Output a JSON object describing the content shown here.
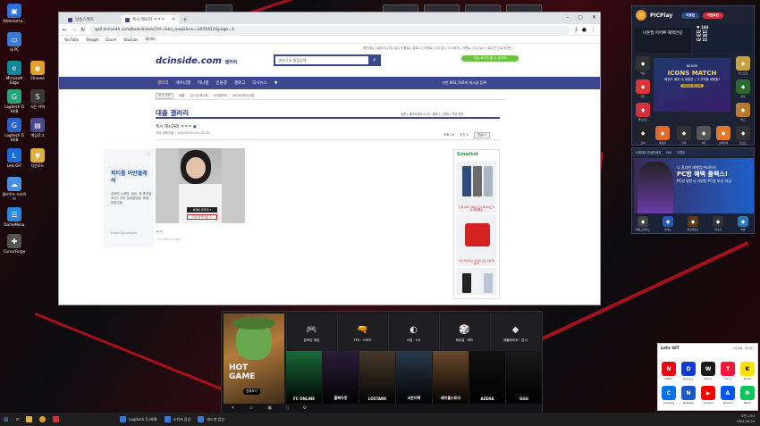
{
  "desktop_icons": [
    {
      "label": "Administra...",
      "color": "#2f6fd6",
      "glyph": "▣"
    },
    {
      "label": "내 PC",
      "color": "#3a7bd5",
      "glyph": "▭"
    },
    {
      "label": "Microsoft Edge",
      "color": "#0f8a9d",
      "glyph": "e"
    },
    {
      "label": "Logitech G HUB",
      "color": "#26a37a",
      "glyph": "G"
    },
    {
      "label": "Chrome",
      "color": "#e0a02a",
      "glyph": "◉"
    },
    {
      "label": "Logitech G HUB",
      "color": "#2a64c8",
      "glyph": "G"
    },
    {
      "label": "서든 어택",
      "color": "#3a3a3a",
      "glyph": "S"
    },
    {
      "label": "게임로그",
      "color": "#4a4a8a",
      "glyph": "▤"
    },
    {
      "label": "Lets OIT",
      "color": "#1f6bd6",
      "glyph": "L"
    },
    {
      "label": "다운로드",
      "color": "#e0b03a",
      "glyph": "▼"
    },
    {
      "label": "클라우드 드라이브",
      "color": "#4a90e2",
      "glyph": "☁"
    },
    {
      "label": "GameMenu",
      "color": "#2a88d8",
      "glyph": "☰"
    },
    {
      "label": "CursorForge",
      "color": "#555",
      "glyph": "✚"
    },
    {
      "label": "aaaaaaa...",
      "color": "#c8441f",
      "glyph": "▲"
    }
  ],
  "top_labels": [
    "스피커 음성",
    "게임 유저",
    "헤드셋",
    "스피커"
  ],
  "browser": {
    "tabs": [
      {
        "label": "방송스케치"
      },
      {
        "label": "혹시 제시카 ㅋㅋㅋ"
      }
    ],
    "url": "gall.dcinside.com/board/view/?id=loan_new1&no=1835912&page=1",
    "bookmarks": [
      "YouTube",
      "Google",
      "Daum",
      "YouTube",
      "네이버"
    ]
  },
  "dc": {
    "top_links": "메인메뉴 | 갤러리 | 미니갤 | 인물갤 | 갤로그 | 이벤트 | 디시콘 | 디시위키 | 이벤트 | 디시뉴스 | 로그인 | 로그아웃",
    "logo": "dcinside.com",
    "logo_sub": "갤러리",
    "search_placeholder": "갤러리 & 통합검색",
    "green_btn": "지금 로그인 할 수 있어요",
    "nav": [
      "갤러리",
      "게이너갤",
      "미니갤",
      "인물갤",
      "갤로그",
      "디시뉴스"
    ],
    "nav_right": "이번 893,746개 게시글 등록",
    "subnav": [
      "최근 방문",
      "대출",
      "실시간 베스트",
      "HIT갤러리",
      "WOW 마이너갤"
    ],
    "gallery_title": "대출 갤러리",
    "gallery_tools": "설정 | 갤러리정보(1/3) | 갤로그 | 알림 | 저장 관리",
    "post_title": "혹시 제시카라 ㅋㅋㅋ",
    "post_meta": "이와 영화어물 | 2024.09.24 05:52:48",
    "stats": {
      "views": "조회 26",
      "recommend": "추천 0",
      "comments": "댓글 0"
    },
    "caption1": "처제와 끝까지??",
    "caption2": "가장 대 즐거운 가",
    "post_text": "ㅋㅋ",
    "post_foot": "- dc official App",
    "left_ad": {
      "title": "피티룸 어반클래식",
      "desc": "주택안 노래방, 로비, 휴 휴게실 40인, 주방 실내멀당닭, 뷔페, 연회주점",
      "url": "https://sportsvib"
    },
    "right_ad": {
      "brand": "Gmarket",
      "cap1": "남성 바지 신축성 스판 빅사이즈 5분 해외배송",
      "cap2": "작가 빅사이즈 반팔티 요즈 5분 배송 빅"
    }
  },
  "dock": {
    "feature": {
      "title_line1": "HOT",
      "title_line2": "GAME",
      "button": "전체보기"
    },
    "categories": [
      {
        "label": "온라인 게임",
        "icon": "🎮"
      },
      {
        "label": "FPS · 스포츠",
        "icon": "🔫"
      },
      {
        "label": "스팀 · CD",
        "icon": "◐"
      },
      {
        "label": "캐주얼 · 보드",
        "icon": "🎲"
      },
      {
        "label": "배틀라이트 · 콘시",
        "icon": "◆"
      }
    ],
    "tiles": [
      {
        "label": "FC ONLINE",
        "bg": "#1a6a3a"
      },
      {
        "label": "블랙아웃",
        "bg": "#2b1e3a"
      },
      {
        "label": "LOSTARK",
        "bg": "#4a3a2a"
      },
      {
        "label": "서든어택",
        "bg": "#2a3a4a"
      },
      {
        "label": "메이플스토리",
        "bg": "#6a4a2a"
      },
      {
        "label": "AZERA",
        "bg": "#111"
      },
      {
        "label": "GGG",
        "bg": "#1a1a1a"
      }
    ]
  },
  "pcplay": {
    "title": "PICPlay",
    "btn1": "이용권",
    "btn2": "이벤트관",
    "promo": "나온엘 머어쁘 혜택안녕",
    "stats": "♥ 144\nLV 12\nLV 34\nLV 22",
    "banner_title": "ICONS MATCH",
    "banner_sub": "NEXON",
    "banner_desc": "레전드 매치 대 대결전 | 그 구력을 대탐험!",
    "banner_date": "2024.10.20",
    "grid": [
      {
        "label": "넥슨",
        "color": "#333"
      },
      {
        "label": "카트",
        "color": "#d33"
      },
      {
        "label": "발로란트",
        "color": "#d3303a"
      },
      {
        "label": "리그오브",
        "color": "#c9a13a"
      },
      {
        "label": "피파",
        "color": "#2a6a2a"
      },
      {
        "label": "배그",
        "color": "#b97a2a"
      },
      {
        "label": "로아",
        "color": "#222"
      },
      {
        "label": "메이플",
        "color": "#e06a2a"
      },
      {
        "label": "던파",
        "color": "#333"
      },
      {
        "label": "서든",
        "color": "#555"
      },
      {
        "label": "오버워치",
        "color": "#e07a2a"
      },
      {
        "label": "로스트",
        "color": "#333"
      }
    ]
  },
  "pc2": {
    "head": [
      "오래대로 안녕하세요",
      "PAY",
      "이벤트"
    ],
    "title": "나 혼자만 레벨업:어라이즈",
    "sub": "PC방 혜택 플렉스!",
    "desc": "PC방 방문시 다양한 PC방 보상 지급",
    "row": [
      {
        "label": "배틀그라운드",
        "color": "#444"
      },
      {
        "label": "레이드",
        "color": "#2a5ab9"
      },
      {
        "label": "워크래프트",
        "color": "#5a3a1a"
      },
      {
        "label": "리니지",
        "color": "#333"
      },
      {
        "label": "바람",
        "color": "#2a7ab9"
      }
    ]
  },
  "letsgit": {
    "title": "Lets GIT",
    "links": "시청기록 · 즐겨찾기",
    "apps": [
      {
        "label": "Netflix",
        "glyph": "N",
        "color": "#e50914"
      },
      {
        "label": "Disney+",
        "glyph": "D",
        "color": "#113ccf"
      },
      {
        "label": "Wavve",
        "glyph": "W",
        "color": "#1a1a1a"
      },
      {
        "label": "Tving",
        "glyph": "T",
        "color": "#ff153c"
      },
      {
        "label": "Kakao",
        "glyph": "K",
        "color": "#fae100"
      },
      {
        "label": "Coupang",
        "glyph": "C",
        "color": "#0073e9"
      },
      {
        "label": "NetBase",
        "glyph": "N",
        "color": "#1a58c8"
      },
      {
        "label": "YouTube",
        "glyph": "▶",
        "color": "#ff0000"
      },
      {
        "label": "Afreeca",
        "glyph": "A",
        "color": "#0057ff"
      },
      {
        "label": "Naver",
        "glyph": "N",
        "color": "#03c75a"
      }
    ]
  },
  "taskbar": {
    "items": [
      {
        "label": "Logitech G HUB"
      },
      {
        "label": "스피커 음성"
      },
      {
        "label": "헤드셋 음성"
      }
    ],
    "time": "오전 1:53",
    "date": "2024-09-24"
  }
}
